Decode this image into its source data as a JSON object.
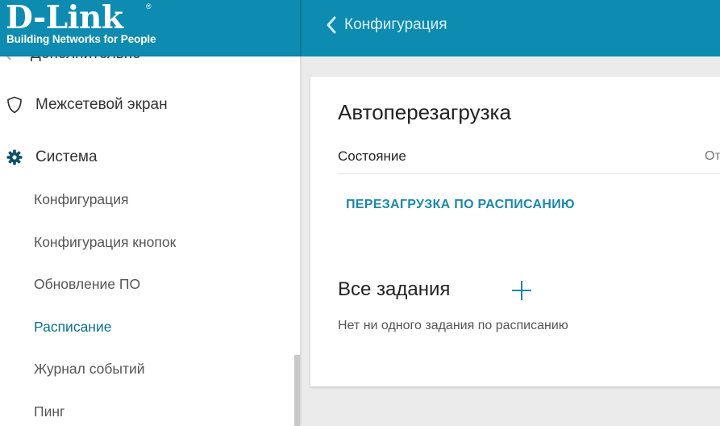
{
  "header": {
    "logo_main": "D-Link",
    "logo_reg": "®",
    "logo_tagline": "Building Networks for People",
    "back_label": "Конфигурация"
  },
  "sidebar": {
    "items": [
      {
        "label": "Дополнительно",
        "icon": "arrows-icon",
        "kind": "main"
      },
      {
        "label": "Межсетевой экран",
        "icon": "shield-icon",
        "kind": "main"
      },
      {
        "label": "Система",
        "icon": "gear-icon",
        "kind": "main"
      }
    ],
    "subitems": [
      {
        "label": "Конфигурация",
        "active": false
      },
      {
        "label": "Конфигурация кнопок",
        "active": false
      },
      {
        "label": "Обновление ПО",
        "active": false
      },
      {
        "label": "Расписание",
        "active": true
      },
      {
        "label": "Журнал событий",
        "active": false
      },
      {
        "label": "Пинг",
        "active": false
      }
    ]
  },
  "main": {
    "title": "Автоперезагрузка",
    "status_label": "Состояние",
    "status_value": "От",
    "schedule_button": "ПЕРЕЗАГРУЗКА ПО РАСПИСАНИЮ",
    "tasks_title": "Все задания",
    "empty_text": "Нет ни одного задания по расписанию"
  },
  "colors": {
    "header_bg": "#0e8bb0",
    "accent": "#1d87a9",
    "active_nav": "#0e6e8e"
  }
}
